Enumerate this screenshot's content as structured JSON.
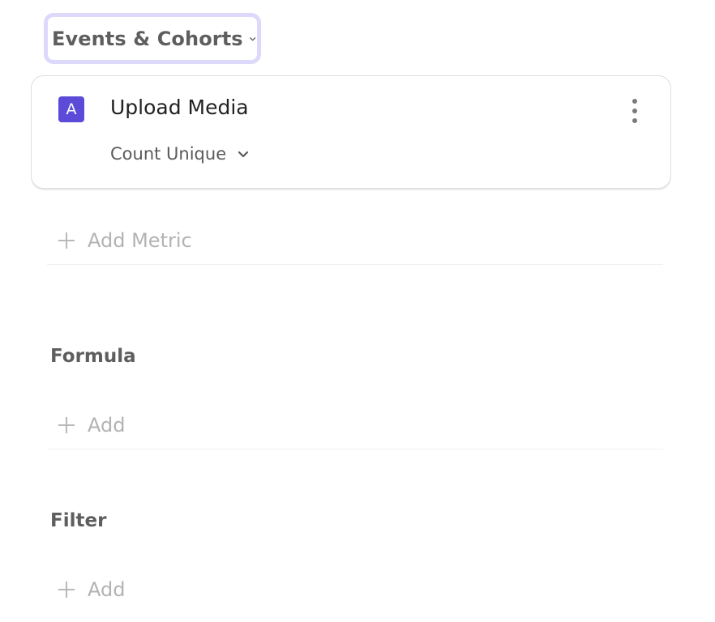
{
  "section_select": {
    "label": "Events & Cohorts",
    "icon": "chevron-down-icon"
  },
  "metric": {
    "badge": "A",
    "badge_color": "#5b4bd8",
    "name": "Upload Media",
    "aggregation": "Count Unique",
    "more_icon": "more-vertical-icon"
  },
  "add_metric": {
    "label": "Add Metric",
    "icon": "plus-icon"
  },
  "formula": {
    "heading": "Formula",
    "add_label": "Add"
  },
  "filter": {
    "heading": "Filter",
    "add_label": "Add"
  },
  "colors": {
    "focus_ring": "#dcd9fb",
    "muted_text": "#b3b3b3"
  }
}
